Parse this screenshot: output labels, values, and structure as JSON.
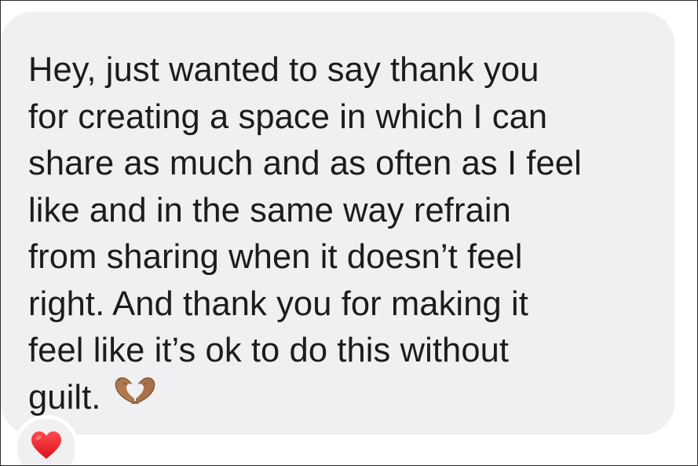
{
  "message": {
    "lines": [
      "Hey, just wanted to say thank you",
      "for creating a space in which I can",
      "share as much and as often as I feel",
      "like and in the same way refrain",
      "from sharing when it doesn’t feel",
      "right. And thank you for making it",
      "feel like it’s ok to do this without",
      "guilt."
    ],
    "trailing_emoji": "heart-hands-icon",
    "bubble_color": "#f0f0f3",
    "text_color": "#1c1c1e"
  },
  "reaction": {
    "emoji": "heart-icon",
    "color": "#e8262d"
  }
}
